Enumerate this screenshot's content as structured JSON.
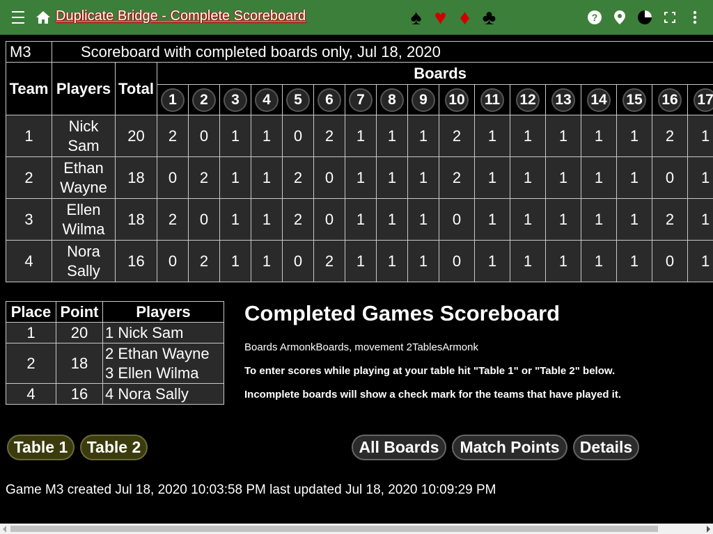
{
  "appbar": {
    "title": "Duplicate Bridge - Complete Scoreboard",
    "suits": [
      "♠",
      "♥",
      "♦",
      "♣"
    ],
    "icons": [
      "menu-icon",
      "home-icon",
      "help-icon",
      "location-icon",
      "theme-icon",
      "fullscreen-icon",
      "more-vert-icon"
    ]
  },
  "scoreboard": {
    "game_id": "M3",
    "caption": "Scoreboard with completed boards only, Jul 18, 2020",
    "headers": {
      "team": "Team",
      "players": "Players",
      "total": "Total",
      "boards": "Boards"
    },
    "board_numbers": [
      "1",
      "2",
      "3",
      "4",
      "5",
      "6",
      "7",
      "8",
      "9",
      "10",
      "11",
      "12",
      "13",
      "14",
      "15",
      "16",
      "17"
    ],
    "rows": [
      {
        "team": "1",
        "player1": "Nick",
        "player2": "Sam",
        "total": "20",
        "scores": [
          "2",
          "0",
          "1",
          "1",
          "0",
          "2",
          "1",
          "1",
          "1",
          "2",
          "1",
          "1",
          "1",
          "1",
          "1",
          "2",
          "1"
        ]
      },
      {
        "team": "2",
        "player1": "Ethan",
        "player2": "Wayne",
        "total": "18",
        "scores": [
          "0",
          "2",
          "1",
          "1",
          "2",
          "0",
          "1",
          "1",
          "1",
          "2",
          "1",
          "1",
          "1",
          "1",
          "1",
          "0",
          "1"
        ]
      },
      {
        "team": "3",
        "player1": "Ellen",
        "player2": "Wilma",
        "total": "18",
        "scores": [
          "2",
          "0",
          "1",
          "1",
          "2",
          "0",
          "1",
          "1",
          "1",
          "0",
          "1",
          "1",
          "1",
          "1",
          "1",
          "2",
          "1"
        ]
      },
      {
        "team": "4",
        "player1": "Nora",
        "player2": "Sally",
        "total": "16",
        "scores": [
          "0",
          "2",
          "1",
          "1",
          "0",
          "2",
          "1",
          "1",
          "1",
          "0",
          "1",
          "1",
          "1",
          "1",
          "1",
          "0",
          "1"
        ]
      }
    ]
  },
  "places": {
    "headers": {
      "place": "Place",
      "point": "Point",
      "players": "Players"
    },
    "rows": [
      {
        "place": "1",
        "point": "20",
        "line1": "1 Nick Sam",
        "line2": ""
      },
      {
        "place": "2",
        "point": "18",
        "line1": "2 Ethan Wayne",
        "line2": "3 Ellen Wilma"
      },
      {
        "place": "4",
        "point": "16",
        "line1": "4 Nora Sally",
        "line2": ""
      }
    ]
  },
  "info": {
    "title": "Completed Games Scoreboard",
    "line1": "Boards ArmonkBoards, movement 2TablesArmonk",
    "line2": "To enter scores while playing at your table hit \"Table 1\" or \"Table 2\" below.",
    "line3": "Incomplete boards will show a check mark for the teams that have played it."
  },
  "buttons": {
    "table1": "Table 1",
    "table2": "Table 2",
    "all_boards": "All Boards",
    "match_points": "Match Points",
    "details": "Details"
  },
  "footer": "Game M3 created Jul 18, 2020 10:03:58 PM last updated Jul 18, 2020 10:09:29 PM",
  "colors": {
    "appbar": "#3c7f3a",
    "title_shadow": "#c00000",
    "red_suit": "#d00000",
    "table_cell": "#2a2a2a",
    "olive_button": "#3b3b0e"
  }
}
